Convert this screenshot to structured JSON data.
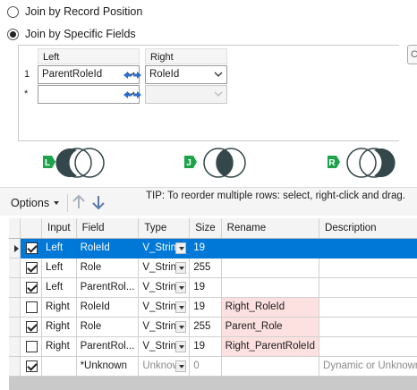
{
  "join_options": {
    "record_position_label": "Join by Record Position",
    "specific_fields_label": "Join by Specific Fields",
    "selected": "specific_fields"
  },
  "join_fields": {
    "left_header": "Left",
    "right_header": "Right",
    "rows": [
      {
        "num": "1",
        "left": "ParentRoleId",
        "right": "RoleId"
      },
      {
        "num": "*",
        "left": "",
        "right": ""
      }
    ]
  },
  "join_outputs": [
    {
      "badge": "L",
      "name": "left-join-venn-icon"
    },
    {
      "badge": "J",
      "name": "inner-join-venn-icon"
    },
    {
      "badge": "R",
      "name": "right-join-venn-icon"
    }
  ],
  "toolbar": {
    "options_label": "Options",
    "tip": "TIP: To reorder multiple rows: select, right-click and drag."
  },
  "grid": {
    "columns": [
      "Input",
      "Field",
      "Type",
      "Size",
      "Rename",
      "Description"
    ],
    "rows": [
      {
        "checked": true,
        "input": "Left",
        "field": "RoleId",
        "type": "V_String",
        "size": "19",
        "rename": "",
        "description": "",
        "selected": true
      },
      {
        "checked": true,
        "input": "Left",
        "field": "Role",
        "type": "V_String",
        "size": "255",
        "rename": "",
        "description": ""
      },
      {
        "checked": true,
        "input": "Left",
        "field": "ParentRol...",
        "type": "V_String",
        "size": "19",
        "rename": "",
        "description": ""
      },
      {
        "checked": false,
        "input": "Right",
        "field": "RoleId",
        "type": "V_String",
        "size": "19",
        "rename": "Right_RoleId",
        "description": ""
      },
      {
        "checked": true,
        "input": "Right",
        "field": "Role",
        "type": "V_String",
        "size": "255",
        "rename": "Parent_Role",
        "description": ""
      },
      {
        "checked": false,
        "input": "Right",
        "field": "ParentRol...",
        "type": "V_String",
        "size": "19",
        "rename": "Right_ParentRoleId",
        "description": ""
      },
      {
        "checked": true,
        "input": "",
        "field": "*Unknown",
        "type": "Unknown",
        "size": "0",
        "rename": "",
        "description": "Dynamic or Unknown Fields",
        "muted": true
      }
    ]
  },
  "colors": {
    "selection": "#0078d7",
    "rename_highlight": "#fde1e1",
    "venn_fill": "#34474a",
    "badge_green": "#1ea34a"
  }
}
